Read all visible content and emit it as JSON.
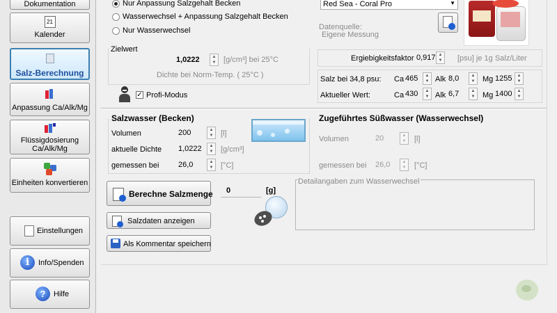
{
  "sidebar": {
    "items": [
      {
        "label": "Dokumentation",
        "icon": "document-icon"
      },
      {
        "label": "Kalender",
        "icon": "calendar-icon",
        "badge": "21"
      },
      {
        "label": "Salz-Berechnung",
        "icon": "salt-icon",
        "active": true
      },
      {
        "label": "Anpassung Ca/Alk/Mg",
        "icon": "bottles-icon"
      },
      {
        "label": "Flüssigdosierung Ca/Alk/Mg",
        "icon": "dosing-icon"
      },
      {
        "label": "Einheiten konvertieren",
        "icon": "convert-icon"
      },
      {
        "label": "Einstellungen",
        "icon": "settings-icon"
      },
      {
        "label": "Info/Spenden",
        "icon": "info-icon",
        "glyph": "i"
      },
      {
        "label": "Hilfe",
        "icon": "help-icon",
        "glyph": "?"
      }
    ]
  },
  "mode": {
    "options": [
      {
        "label": "Nur Anpassung Salzgehalt Becken",
        "selected": true
      },
      {
        "label": "Wasserwechsel + Anpassung Salzgehalt Becken",
        "selected": false
      },
      {
        "label": "Nur Wasserwechsel",
        "selected": false
      }
    ]
  },
  "target": {
    "heading": "Zielwert",
    "value": "1,0222",
    "unit": "[g/cm³] bei 25°C",
    "note": "Dichte bei Norm-Temp. ( 25°C  )",
    "profi_label": "Profi-Modus",
    "profi_checked": true
  },
  "salt": {
    "selected": "Red Sea - Coral Pro",
    "source_label": "Datenquelle:",
    "source_value": "Eigene Messung",
    "yield_label": "Ergiebigkeitsfaktor",
    "yield_value": "0,917",
    "yield_unit": "[psu] je 1g Salz/Liter",
    "rows": [
      {
        "label": "Salz bei 34,8 psu:",
        "ca_label": "Ca",
        "ca": "465",
        "alk_label": "Alk",
        "alk": "8,0",
        "mg_label": "Mg",
        "mg": "1255"
      },
      {
        "label": "Aktueller Wert:",
        "ca_label": "Ca",
        "ca": "430",
        "alk_label": "Alk",
        "alk": "6,7",
        "mg_label": "Mg",
        "mg": "1400"
      }
    ]
  },
  "tank": {
    "heading": "Salzwasser (Becken)",
    "volume_label": "Volumen",
    "volume": "200",
    "volume_unit": "[l]",
    "density_label": "aktuelle Dichte",
    "density": "1,0222",
    "density_unit": "[g/cm³]",
    "temp_label": "gemessen bei",
    "temp": "26,0",
    "temp_unit": "[°C]"
  },
  "fresh": {
    "heading": "Zugeführtes Süßwasser (Wasserwechsel)",
    "volume_label": "Volumen",
    "volume": "20",
    "volume_unit": "[l]",
    "temp_label": "gemessen bei",
    "temp": "26,0",
    "temp_unit": "[°C]",
    "details_label": "Detailangaben zum Wasserwechsel"
  },
  "actions": {
    "calc_label": "Berechne Salzmenge",
    "result": "0",
    "result_unit": "[g]",
    "show_label": "Salzdaten anzeigen",
    "save_label": "Als Kommentar speichern"
  },
  "colors": {
    "accent": "#1c4f9c",
    "active_border": "#3c7fb1"
  }
}
